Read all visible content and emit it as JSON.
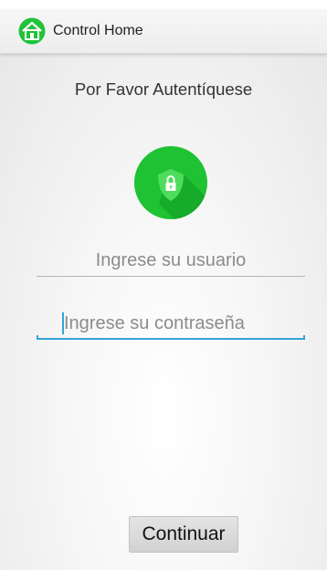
{
  "action_bar": {
    "title": "Control Home",
    "icon": "home-app-icon"
  },
  "login": {
    "heading": "Por Favor Autentíquese",
    "lock_icon": "lock-shield-icon",
    "username_placeholder": "Ingrese su usuario",
    "password_placeholder": "Ingrese su contraseña",
    "continue_label": "Continuar"
  },
  "colors": {
    "brand_green": "#1ec232",
    "focus_blue": "#33a4d9"
  }
}
